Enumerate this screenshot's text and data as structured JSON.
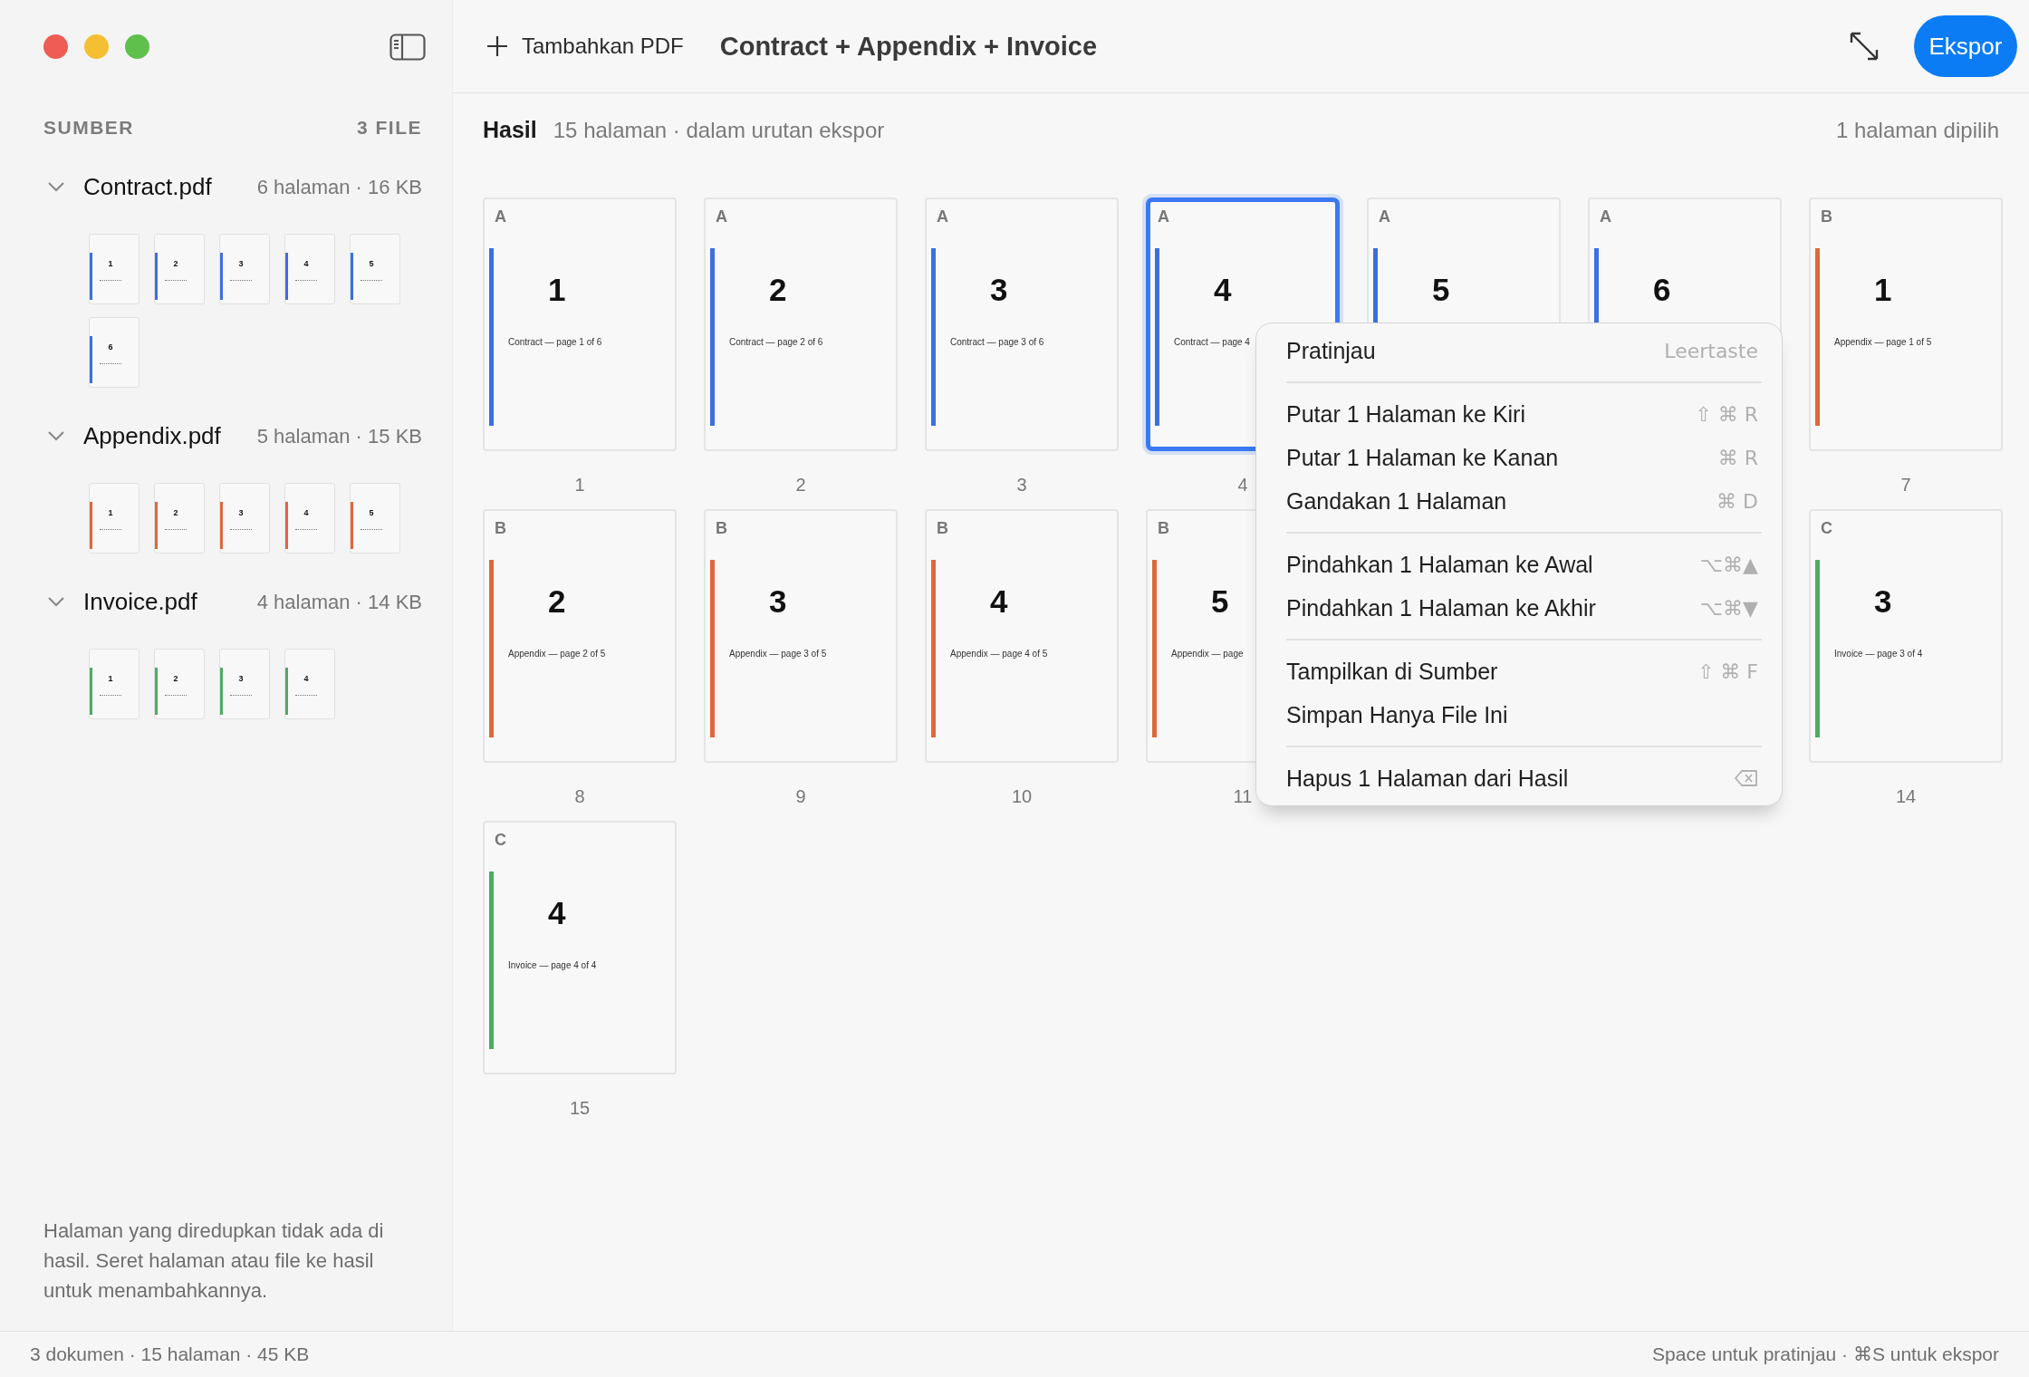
{
  "sidebar": {
    "heading": "SUMBER",
    "count": "3 FILE",
    "files": [
      {
        "name": "Contract.pdf",
        "meta": "6 halaman · 16 KB",
        "expanded": true,
        "color": "#3b6fe0",
        "pages": [
          "1",
          "2",
          "3",
          "4",
          "5",
          "6"
        ]
      },
      {
        "name": "Appendix.pdf",
        "meta": "5 halaman · 15 KB",
        "expanded": true,
        "color": "#e0673a",
        "pages": [
          "1",
          "2",
          "3",
          "4",
          "5"
        ]
      },
      {
        "name": "Invoice.pdf",
        "meta": "4 halaman · 14 KB",
        "expanded": true,
        "color": "#4bad62",
        "pages": [
          "1",
          "2",
          "3",
          "4"
        ]
      }
    ],
    "note": "Halaman yang diredupkan tidak ada di hasil. Seret halaman atau file ke hasil untuk menambahkannya."
  },
  "toolbar": {
    "add_label": "Tambahkan PDF",
    "title": "Contract + Appendix + Invoice",
    "export_label": "Ekspor"
  },
  "result": {
    "heading": "Hasil",
    "summary": "15 halaman · dalam urutan ekspor",
    "selection": "1 halaman dipilih",
    "pages": [
      {
        "kind": "page",
        "source": "A",
        "number": "1",
        "caption": "Contract — page 1 of 6",
        "label": "1",
        "color": "#3b6fe0",
        "selected": false
      },
      {
        "kind": "page",
        "source": "A",
        "number": "2",
        "caption": "Contract — page 2 of 6",
        "label": "2",
        "color": "#3b6fe0",
        "selected": false
      },
      {
        "kind": "page",
        "source": "A",
        "number": "3",
        "caption": "Contract — page 3 of 6",
        "label": "3",
        "color": "#3b6fe0",
        "selected": false
      },
      {
        "kind": "page",
        "source": "A",
        "number": "4",
        "caption": "Contract — page 4",
        "label": "4",
        "color": "#3b6fe0",
        "selected": true
      },
      {
        "kind": "page",
        "source": "A",
        "number": "5",
        "color": "#3b6fe0",
        "selected": false
      },
      {
        "kind": "page",
        "source": "A",
        "number": "6",
        "color": "#3b6fe0",
        "selected": false
      },
      {
        "kind": "page",
        "source": "B",
        "number": "1",
        "caption": "Appendix — page 1 of 5",
        "label": "7",
        "color": "#e0673a",
        "selected": false
      },
      {
        "kind": "page",
        "source": "B",
        "number": "2",
        "caption": "Appendix — page 2 of 5",
        "label": "8",
        "color": "#e0673a",
        "selected": false
      },
      {
        "kind": "page",
        "source": "B",
        "number": "3",
        "caption": "Appendix — page 3 of 5",
        "label": "9",
        "color": "#e0673a",
        "selected": false
      },
      {
        "kind": "page",
        "source": "B",
        "number": "4",
        "caption": "Appendix — page 4 of 5",
        "label": "10",
        "color": "#e0673a",
        "selected": false
      },
      {
        "kind": "page",
        "source": "B",
        "number": "5",
        "caption": "Appendix — page",
        "label": "11",
        "color": "#e0673a",
        "selected": false
      },
      {
        "kind": "covered"
      },
      {
        "kind": "covered"
      },
      {
        "kind": "page",
        "source": "C",
        "number": "3",
        "caption": "Invoice — page 3 of 4",
        "label": "14",
        "color": "#4bad62",
        "selected": false
      },
      {
        "kind": "page",
        "source": "C",
        "number": "4",
        "caption": "Invoice — page 4 of 4",
        "label": "15",
        "color": "#4bad62",
        "selected": false
      }
    ]
  },
  "context_menu": {
    "groups": [
      {
        "items": [
          {
            "label": "Pratinjau",
            "kind": "text",
            "shortcut": "Leertaste"
          }
        ]
      },
      {
        "items": [
          {
            "label": "Putar 1 Halaman ke Kiri",
            "kind": "text",
            "shortcut": "⇧ ⌘ R"
          },
          {
            "label": "Putar 1 Halaman ke Kanan",
            "kind": "text",
            "shortcut": "⌘ R"
          },
          {
            "label": "Gandakan 1 Halaman",
            "kind": "text",
            "shortcut": "⌘ D"
          }
        ]
      },
      {
        "items": [
          {
            "label": "Pindahkan 1 Halaman ke Awal",
            "kind": "text",
            "shortcut": "⌥⌘▲"
          },
          {
            "label": "Pindahkan 1 Halaman ke Akhir",
            "kind": "text",
            "shortcut": "⌥⌘▼"
          }
        ]
      },
      {
        "items": [
          {
            "label": "Tampilkan di Sumber",
            "kind": "text",
            "shortcut": "⇧ ⌘ F"
          },
          {
            "label": "Simpan Hanya File Ini",
            "kind": "none"
          }
        ]
      },
      {
        "items": [
          {
            "label": "Hapus 1 Halaman dari Hasil",
            "kind": "delete-key"
          }
        ]
      }
    ]
  },
  "status_bar": {
    "left": "3 dokumen · 15 halaman · 45 KB",
    "right": "Space untuk pratinjau · ⌘S untuk ekspor"
  }
}
